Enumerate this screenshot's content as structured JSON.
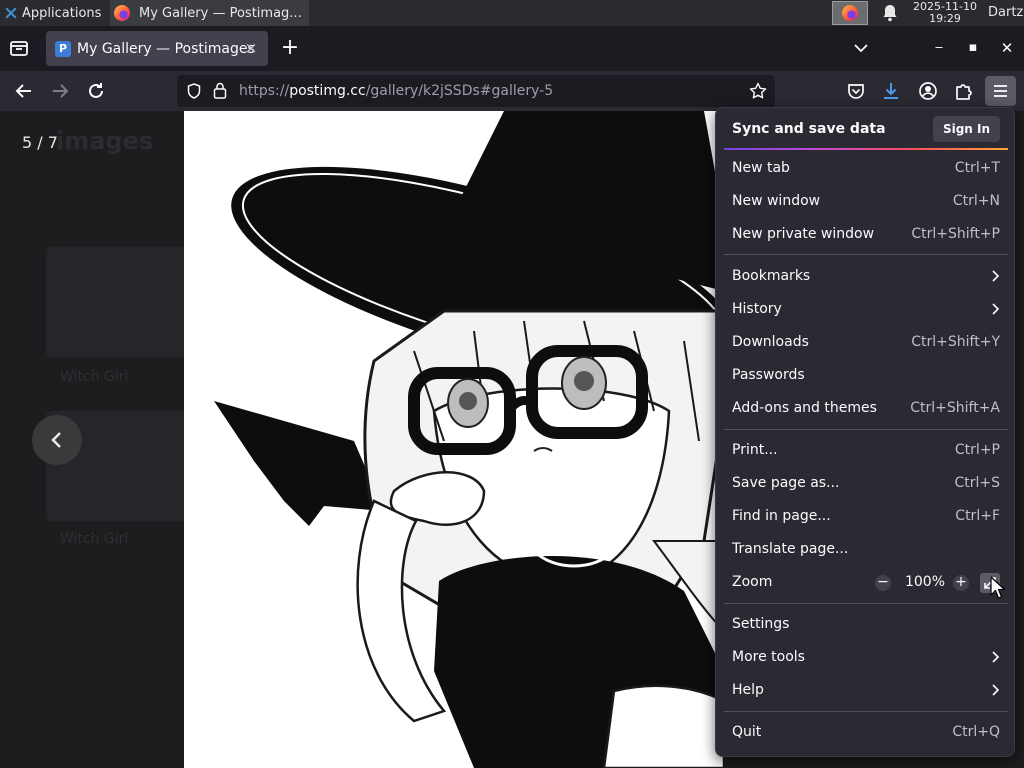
{
  "taskbar": {
    "apps_label": "Applications",
    "task_title": "My Gallery — Postimag...",
    "clock_date": "2025-11-10",
    "clock_time": "19:29",
    "user": "Dartz"
  },
  "browser": {
    "tab": {
      "favicon": "P",
      "title": "My Gallery — Postimages",
      "close": "×"
    },
    "new_tab": "+",
    "window_controls": {
      "minimize": "‒",
      "maximize": "▪",
      "close": "✕"
    },
    "url": {
      "scheme": "https://",
      "host": "postimg.cc",
      "path": "/gallery/k2jSSDs#gallery-5"
    }
  },
  "page": {
    "counter": "5 / 7",
    "ghost_title": "images",
    "ghost_labels": [
      "Witch Girl",
      "Witch Girl"
    ]
  },
  "menu": {
    "header": "Sync and save data",
    "sign_in": "Sign In",
    "items": [
      {
        "label": "New tab",
        "shortcut": "Ctrl+T"
      },
      {
        "label": "New window",
        "shortcut": "Ctrl+N"
      },
      {
        "label": "New private window",
        "shortcut": "Ctrl+Shift+P"
      },
      {
        "label": "Bookmarks",
        "submenu": true
      },
      {
        "label": "History",
        "submenu": true
      },
      {
        "label": "Downloads",
        "shortcut": "Ctrl+Shift+Y"
      },
      {
        "label": "Passwords"
      },
      {
        "label": "Add-ons and themes",
        "shortcut": "Ctrl+Shift+A"
      },
      {
        "label": "Print...",
        "shortcut": "Ctrl+P"
      },
      {
        "label": "Save page as...",
        "shortcut": "Ctrl+S"
      },
      {
        "label": "Find in page...",
        "shortcut": "Ctrl+F"
      },
      {
        "label": "Translate page..."
      },
      {
        "label": "Zoom",
        "zoom": "100%",
        "zoom_out": "−",
        "zoom_in": "+"
      },
      {
        "label": "Settings"
      },
      {
        "label": "More tools",
        "submenu": true
      },
      {
        "label": "Help",
        "submenu": true
      },
      {
        "label": "Quit",
        "shortcut": "Ctrl+Q"
      }
    ]
  },
  "colors": {
    "taskbar": "#2a2b2e",
    "tabbar": "#1c1b22",
    "navbar": "#2b2a33",
    "menu_bg": "#2b2a33",
    "accent_gradient": [
      "#7542e5",
      "#ff4f5e",
      "#ffa436"
    ]
  }
}
